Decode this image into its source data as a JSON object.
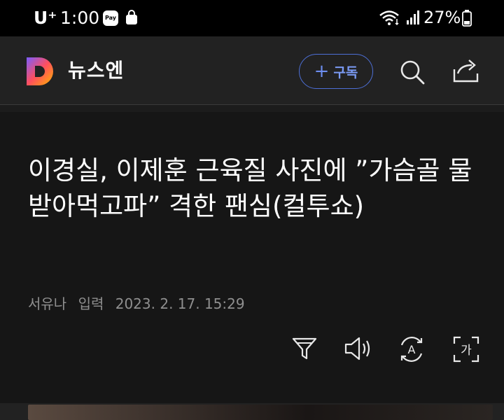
{
  "status_bar": {
    "carrier": "U⁺",
    "time": "1:00",
    "pay_badge": "Pay",
    "battery": "27%",
    "icons": [
      "pay-icon",
      "shopping-bag-icon",
      "wifi-icon",
      "signal-icon",
      "battery-icon"
    ]
  },
  "app_bar": {
    "logo_letter": "D",
    "app_name": "뉴스엔",
    "subscribe_label": "구독",
    "icons": [
      "search-icon",
      "share-icon"
    ],
    "accent_color": "#4d6fd6"
  },
  "article": {
    "headline": "이경실, 이제훈 근육질 사진에 ”가슴골 물 받아먹고파” 격한 팬심(컬투쇼)",
    "author": "서유나",
    "input_label": "입력",
    "datetime": "2023. 2. 17. 15:29",
    "tools": [
      "filter-icon",
      "speaker-icon",
      "translate-icon",
      "font-size-icon"
    ]
  }
}
